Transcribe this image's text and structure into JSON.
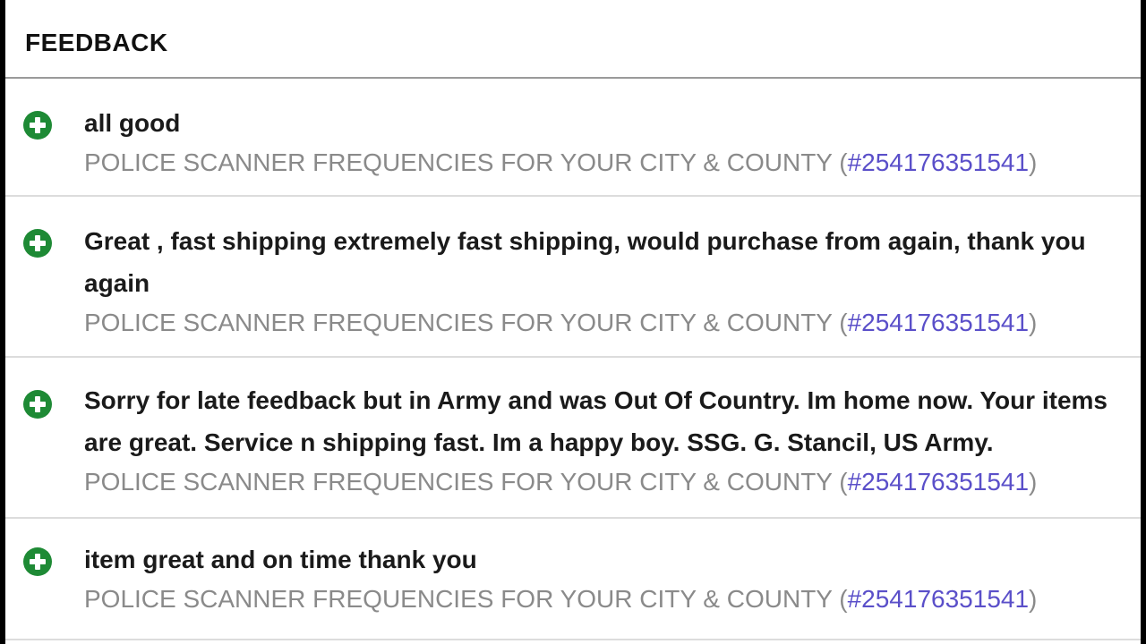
{
  "header": {
    "title": "FEEDBACK"
  },
  "feedback": [
    {
      "icon": "positive-plus-icon",
      "comment": "all good",
      "item_title": "POLICE SCANNER FREQUENCIES FOR YOUR CITY & COUNTY",
      "item_number": "#254176351541"
    },
    {
      "icon": "positive-plus-icon",
      "comment": "Great , fast shipping extremely fast shipping, would purchase from again, thank you again",
      "item_title": "POLICE SCANNER FREQUENCIES FOR YOUR CITY & COUNTY",
      "item_number": "#254176351541"
    },
    {
      "icon": "positive-plus-icon",
      "comment": "Sorry for late feedback but in Army and was Out Of Country. Im home now. Your items are great. Service n shipping fast. Im a happy boy. SSG. G. Stancil, US Army.",
      "item_title": "POLICE SCANNER FREQUENCIES FOR YOUR CITY & COUNTY",
      "item_number": "#254176351541"
    },
    {
      "icon": "positive-plus-icon",
      "comment": "item great and on time thank you",
      "item_title": "POLICE SCANNER FREQUENCIES FOR YOUR CITY & COUNTY",
      "item_number": "#254176351541"
    }
  ],
  "colors": {
    "positive": "#1e8a35",
    "link": "#5a4fc9",
    "muted_text": "#8a8a8a"
  }
}
